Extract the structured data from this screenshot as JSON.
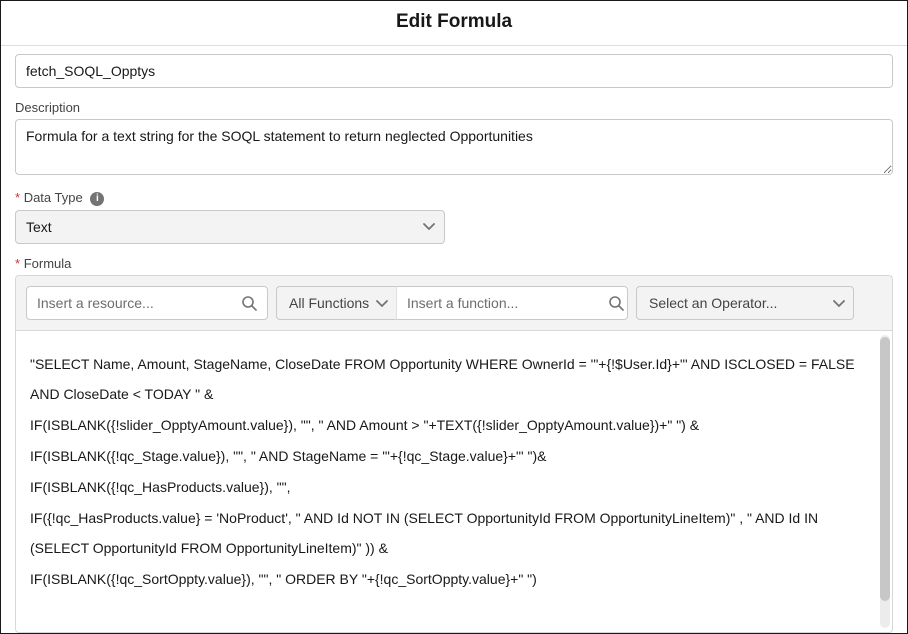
{
  "header": {
    "title": "Edit Formula"
  },
  "name": {
    "value": "fetch_SOQL_Opptys"
  },
  "description": {
    "label": "Description",
    "value": "Formula for a text string for the SOQL statement to return neglected Opportunities"
  },
  "dataType": {
    "label": "Data Type",
    "value": "Text"
  },
  "formula": {
    "label": "Formula",
    "resourcePlaceholder": "Insert a resource...",
    "funcDropdownLabel": "All Functions",
    "funcSearchPlaceholder": "Insert a function...",
    "operatorPlaceholder": "Select an Operator...",
    "body": "\"SELECT Name, Amount, StageName, CloseDate FROM Opportunity WHERE OwnerId = '\"+{!$User.Id}+\"' AND ISCLOSED = FALSE AND CloseDate < TODAY \" &\nIF(ISBLANK({!slider_OpptyAmount.value}), \"\", \" AND Amount > \"+TEXT({!slider_OpptyAmount.value})+\" \") &\nIF(ISBLANK({!qc_Stage.value}), \"\", \" AND StageName = '\"+{!qc_Stage.value}+\"' \")&\nIF(ISBLANK({!qc_HasProducts.value}), \"\",\nIF({!qc_HasProducts.value} = 'NoProduct', \" AND Id NOT IN (SELECT OpportunityId FROM OpportunityLineItem)\" , \" AND Id IN (SELECT OpportunityId FROM OpportunityLineItem)\" )) &\nIF(ISBLANK({!qc_SortOppty.value}), \"\", \" ORDER BY \"+{!qc_SortOppty.value}+\" \")"
  }
}
